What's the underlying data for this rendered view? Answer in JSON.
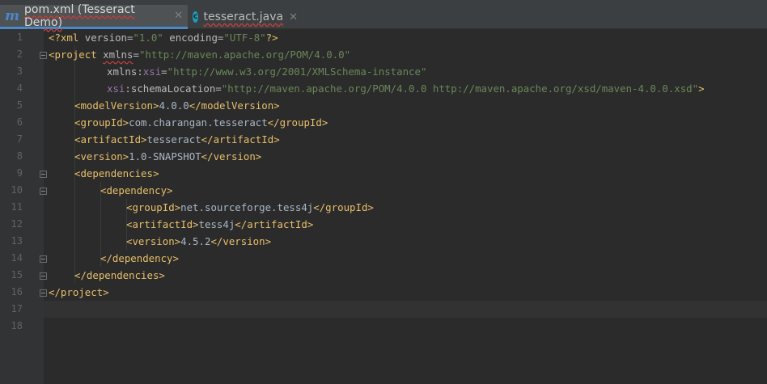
{
  "tabs": [
    {
      "label": "pom.xml (Tesseract Demo)",
      "icon": "maven-icon",
      "icon_glyph": "m",
      "close": "✕",
      "active": true
    },
    {
      "label": "tesseract.java",
      "icon": "java-class-icon",
      "icon_glyph": "c",
      "close": "✕",
      "active": false
    }
  ],
  "line_numbers": [
    "1",
    "2",
    "3",
    "4",
    "5",
    "6",
    "7",
    "8",
    "9",
    "10",
    "11",
    "12",
    "13",
    "14",
    "15",
    "16",
    "17",
    "18"
  ],
  "code": {
    "l1": {
      "open": "<?xml ",
      "a1": "version",
      "eq1": "=",
      "v1": "\"1.0\"",
      "sp": " ",
      "a2": "encoding",
      "eq2": "=",
      "v2": "\"UTF-8\"",
      "close": "?>"
    },
    "l2": {
      "open": "<project",
      "sp": " ",
      "a1": "xmlns",
      "eq": "=",
      "v1": "\"http://maven.apache.org/POM/4.0.0\""
    },
    "l3": {
      "a1": "xmlns",
      "colon": ":",
      "ns": "xsi",
      "eq": "=",
      "v1": "\"http://www.w3.org/2001/XMLSchema-instance\""
    },
    "l4": {
      "ns": "xsi",
      "colon": ":",
      "a1": "schemaLocation",
      "eq": "=",
      "v1": "\"http://maven.apache.org/POM/4.0.0 http://maven.apache.org/xsd/maven-4.0.0.xsd\"",
      "close": ">"
    },
    "l5": {
      "open": "<modelVersion>",
      "text": "4.0.0",
      "close": "</modelVersion>"
    },
    "l6": {
      "open": "<groupId>",
      "text": "com.charangan.tesseract",
      "close": "</groupId>"
    },
    "l7": {
      "open": "<artifactId>",
      "text": "tesseract",
      "close": "</artifactId>"
    },
    "l8": {
      "open": "<version>",
      "text": "1.0-SNAPSHOT",
      "close": "</version>"
    },
    "l9": {
      "open": "<dependencies>"
    },
    "l10": {
      "open": "<dependency>"
    },
    "l11": {
      "open": "<groupId>",
      "text": "net.sourceforge.tess4j",
      "close": "</groupId>"
    },
    "l12": {
      "open": "<artifactId>",
      "text": "tess4j",
      "close": "</artifactId>"
    },
    "l13": {
      "open": "<version>",
      "text": "4.5.2",
      "close": "</version>"
    },
    "l14": {
      "close": "</dependency>"
    },
    "l15": {
      "close": "</dependencies>"
    },
    "l16": {
      "close": "</project>"
    }
  },
  "colors": {
    "background": "#2b2b2b",
    "gutter": "#313335",
    "tag": "#e8bf6a",
    "attribute": "#bababa",
    "namespace": "#9876aa",
    "string": "#6a8759",
    "text": "#a9b7c6",
    "line_number": "#606366",
    "tab_accent": "#4a88c7"
  }
}
